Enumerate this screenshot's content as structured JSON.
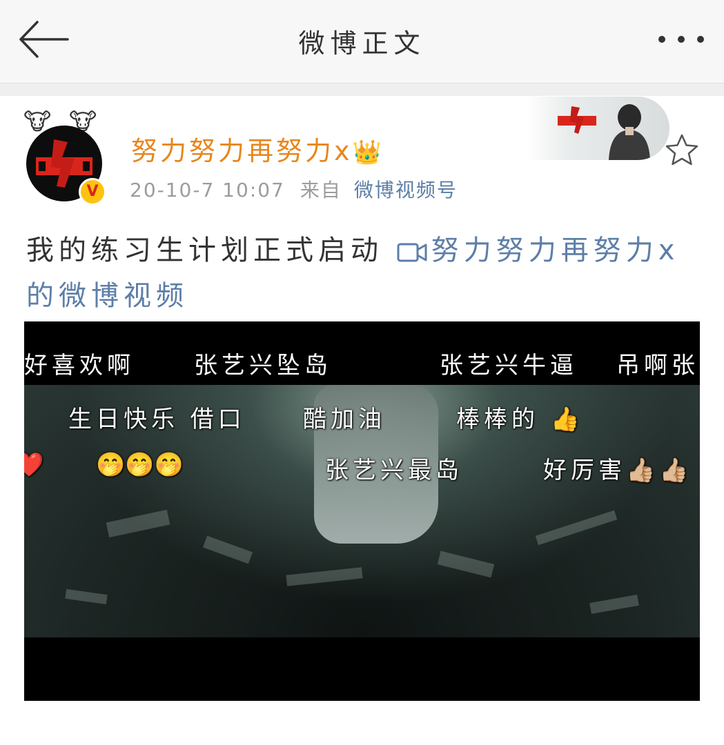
{
  "nav": {
    "title": "微博正文",
    "back_icon": "arrow-left-icon",
    "more_icon": "more-dots-icon"
  },
  "post": {
    "author": {
      "name": "努力努力再努力x",
      "crown_icon": "👑",
      "avatar_decoration": "🐮",
      "verified_badge": "V",
      "name_color": "#e8861e"
    },
    "meta": {
      "date": "20-10-7 10:07",
      "from_label": "来自",
      "source": "微博视频号"
    },
    "text": "我的练习生计划正式启动 ",
    "video_link": "努力努力再努力x的微博视频",
    "link_color": "#5d7ea8",
    "star_icon": "star-outline-icon"
  },
  "video": {
    "danmaku": [
      {
        "text": "好喜欢啊"
      },
      {
        "text": "张艺兴坠岛"
      },
      {
        "text": "张艺兴牛逼"
      },
      {
        "text": "吊啊张"
      },
      {
        "text": "生日快乐 借口"
      },
      {
        "text": "酷加油"
      },
      {
        "text": "棒棒的 👍"
      },
      {
        "text": "❤️"
      },
      {
        "text": "🤭🤭🤭"
      },
      {
        "text": "张艺兴最岛"
      },
      {
        "text": "好厉害👍🏼👍🏼"
      }
    ]
  }
}
